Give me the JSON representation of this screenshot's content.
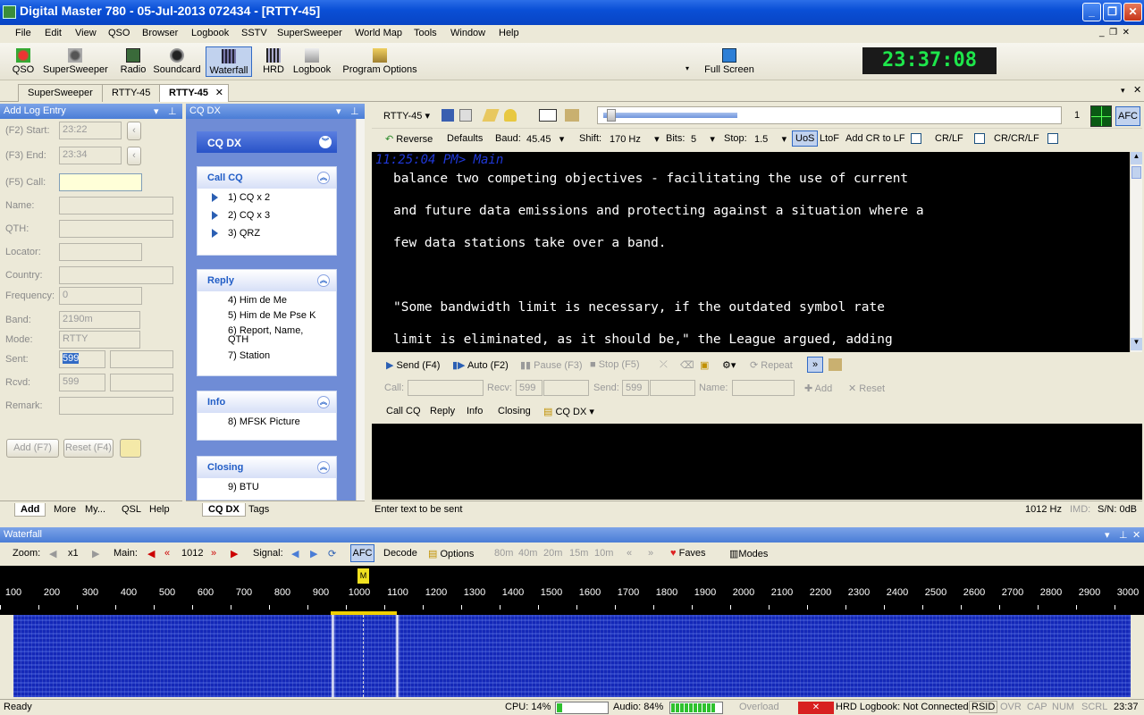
{
  "window": {
    "title": "Digital Master 780 - 05-Jul-2013 072434 - [RTTY-45]"
  },
  "menu": [
    "File",
    "Edit",
    "View",
    "QSO",
    "Browser",
    "Logbook",
    "SSTV",
    "SuperSweeper",
    "World Map",
    "Tools",
    "Window",
    "Help"
  ],
  "toolbar": {
    "qso": "QSO",
    "supersweeper": "SuperSweeper",
    "radio": "Radio",
    "soundcard": "Soundcard",
    "waterfall": "Waterfall",
    "hrd": "HRD",
    "logbook": "Logbook",
    "program_options": "Program Options",
    "full_screen": "Full Screen"
  },
  "clock": "23:37:08",
  "doc_tabs": [
    "SuperSweeper",
    "RTTY-45",
    "RTTY-45"
  ],
  "log": {
    "header": "Add Log Entry",
    "start_label": "(F2) Start:",
    "start_value": "23:22",
    "end_label": "(F3) End:",
    "end_value": "23:34",
    "call_label": "(F5) Call:",
    "name_label": "Name:",
    "qth_label": "QTH:",
    "locator_label": "Locator:",
    "country_label": "Country:",
    "frequency_label": "Frequency:",
    "frequency_value": "0",
    "band_label": "Band:",
    "band_value": "2190m",
    "mode_label": "Mode:",
    "mode_value": "RTTY",
    "sent_label": "Sent:",
    "sent_value": "599",
    "rcvd_label": "Rcvd:",
    "rcvd_value": "599",
    "remark_label": "Remark:",
    "add_button": "Add (F7)",
    "reset_button": "Reset (F4)",
    "tabs": [
      "Add",
      "More",
      "My...",
      "QSL",
      "Help"
    ]
  },
  "cq": {
    "header": "CQ DX",
    "title": "CQ DX",
    "groups": [
      {
        "title": "Call CQ",
        "items": [
          "1)  CQ x 2",
          "2)  CQ x 3",
          "3)  QRZ"
        ]
      },
      {
        "title": "Reply",
        "items": [
          "4)  Him de Me",
          "5)  Him de Me Pse K",
          "6)  Report, Name,",
          "QTH",
          "7)  Station"
        ]
      },
      {
        "title": "Info",
        "items": [
          "8)  MFSK Picture"
        ]
      },
      {
        "title": "Closing",
        "items": [
          "9)  BTU"
        ]
      }
    ],
    "tabs": [
      "CQ DX",
      "Tags"
    ]
  },
  "rtty": {
    "mode": "RTTY-45",
    "afc": "AFC",
    "level": "1",
    "reverse": "Reverse",
    "defaults": "Defaults",
    "baud_label": "Baud:",
    "baud_value": "45.45",
    "shift_label": "Shift:",
    "shift_value": "170 Hz",
    "bits_label": "Bits:",
    "bits_value": "5",
    "stop_label": "Stop:",
    "stop_value": "1.5",
    "uos": "UoS",
    "ltof": "LtoF",
    "addcr": "Add CR to LF",
    "crlf": "CR/LF",
    "crcrlf": "CR/CR/LF",
    "timestamp": "11:25:04 PM> Main",
    "lines": [
      "balance two competing objectives - facilitating the use of current",
      "and future data emissions and protecting against a situation where a",
      "few data stations take over a band.",
      "",
      "\"Some bandwidth limit is necessary, if the outdated symbol rate",
      "limit is eliminated, as it should be,\" the League argued, adding"
    ],
    "tx": {
      "send": "Send  (F4)",
      "auto": "Auto  (F2)",
      "pause": "Pause  (F3)",
      "stop": "Stop  (F5)",
      "repeat": "Repeat"
    },
    "qso": {
      "call_label": "Call:",
      "recv_label": "Recv:",
      "recv_value": "599",
      "send_label": "Send:",
      "send_value": "599",
      "name_label": "Name:",
      "add": "Add",
      "reset": "Reset"
    },
    "macros": [
      "Call CQ",
      "Reply",
      "Info",
      "Closing",
      "CQ DX"
    ],
    "tx_placeholder": "Enter text to be sent",
    "freq": "1012 Hz",
    "imd": "IMD:",
    "sn": "S/N: 0dB"
  },
  "waterfall": {
    "header": "Waterfall",
    "zoom_label": "Zoom:",
    "zoom_value": "x1",
    "main_label": "Main:",
    "main_value": "1012",
    "signal_label": "Signal:",
    "afc": "AFC",
    "decode": "Decode",
    "options": "Options",
    "bands": [
      "80m",
      "40m",
      "20m",
      "15m",
      "10m"
    ],
    "faves": "Faves",
    "modes": "Modes",
    "scale": [
      "100",
      "200",
      "300",
      "400",
      "500",
      "600",
      "700",
      "800",
      "900",
      "1000",
      "1100",
      "1200",
      "1300",
      "1400",
      "1500",
      "1600",
      "1700",
      "1800",
      "1900",
      "2000",
      "2100",
      "2200",
      "2300",
      "2400",
      "2500",
      "2600",
      "2700",
      "2800",
      "2900",
      "3000"
    ]
  },
  "status": {
    "ready": "Ready",
    "cpu": "CPU: 14%",
    "audio": "Audio: 84%",
    "overload": "Overload",
    "hrd": "HRD Logbook: Not Connected",
    "rsid": "RSID",
    "ovr": "OVR",
    "cap": "CAP",
    "num": "NUM",
    "scrl": "SCRL",
    "time": "23:37"
  },
  "colors": {
    "accent": "#316ac5",
    "title_blue": "#0a4fd6",
    "clock_green": "#1ee64b",
    "waterfall_blue": "#1428b8"
  }
}
